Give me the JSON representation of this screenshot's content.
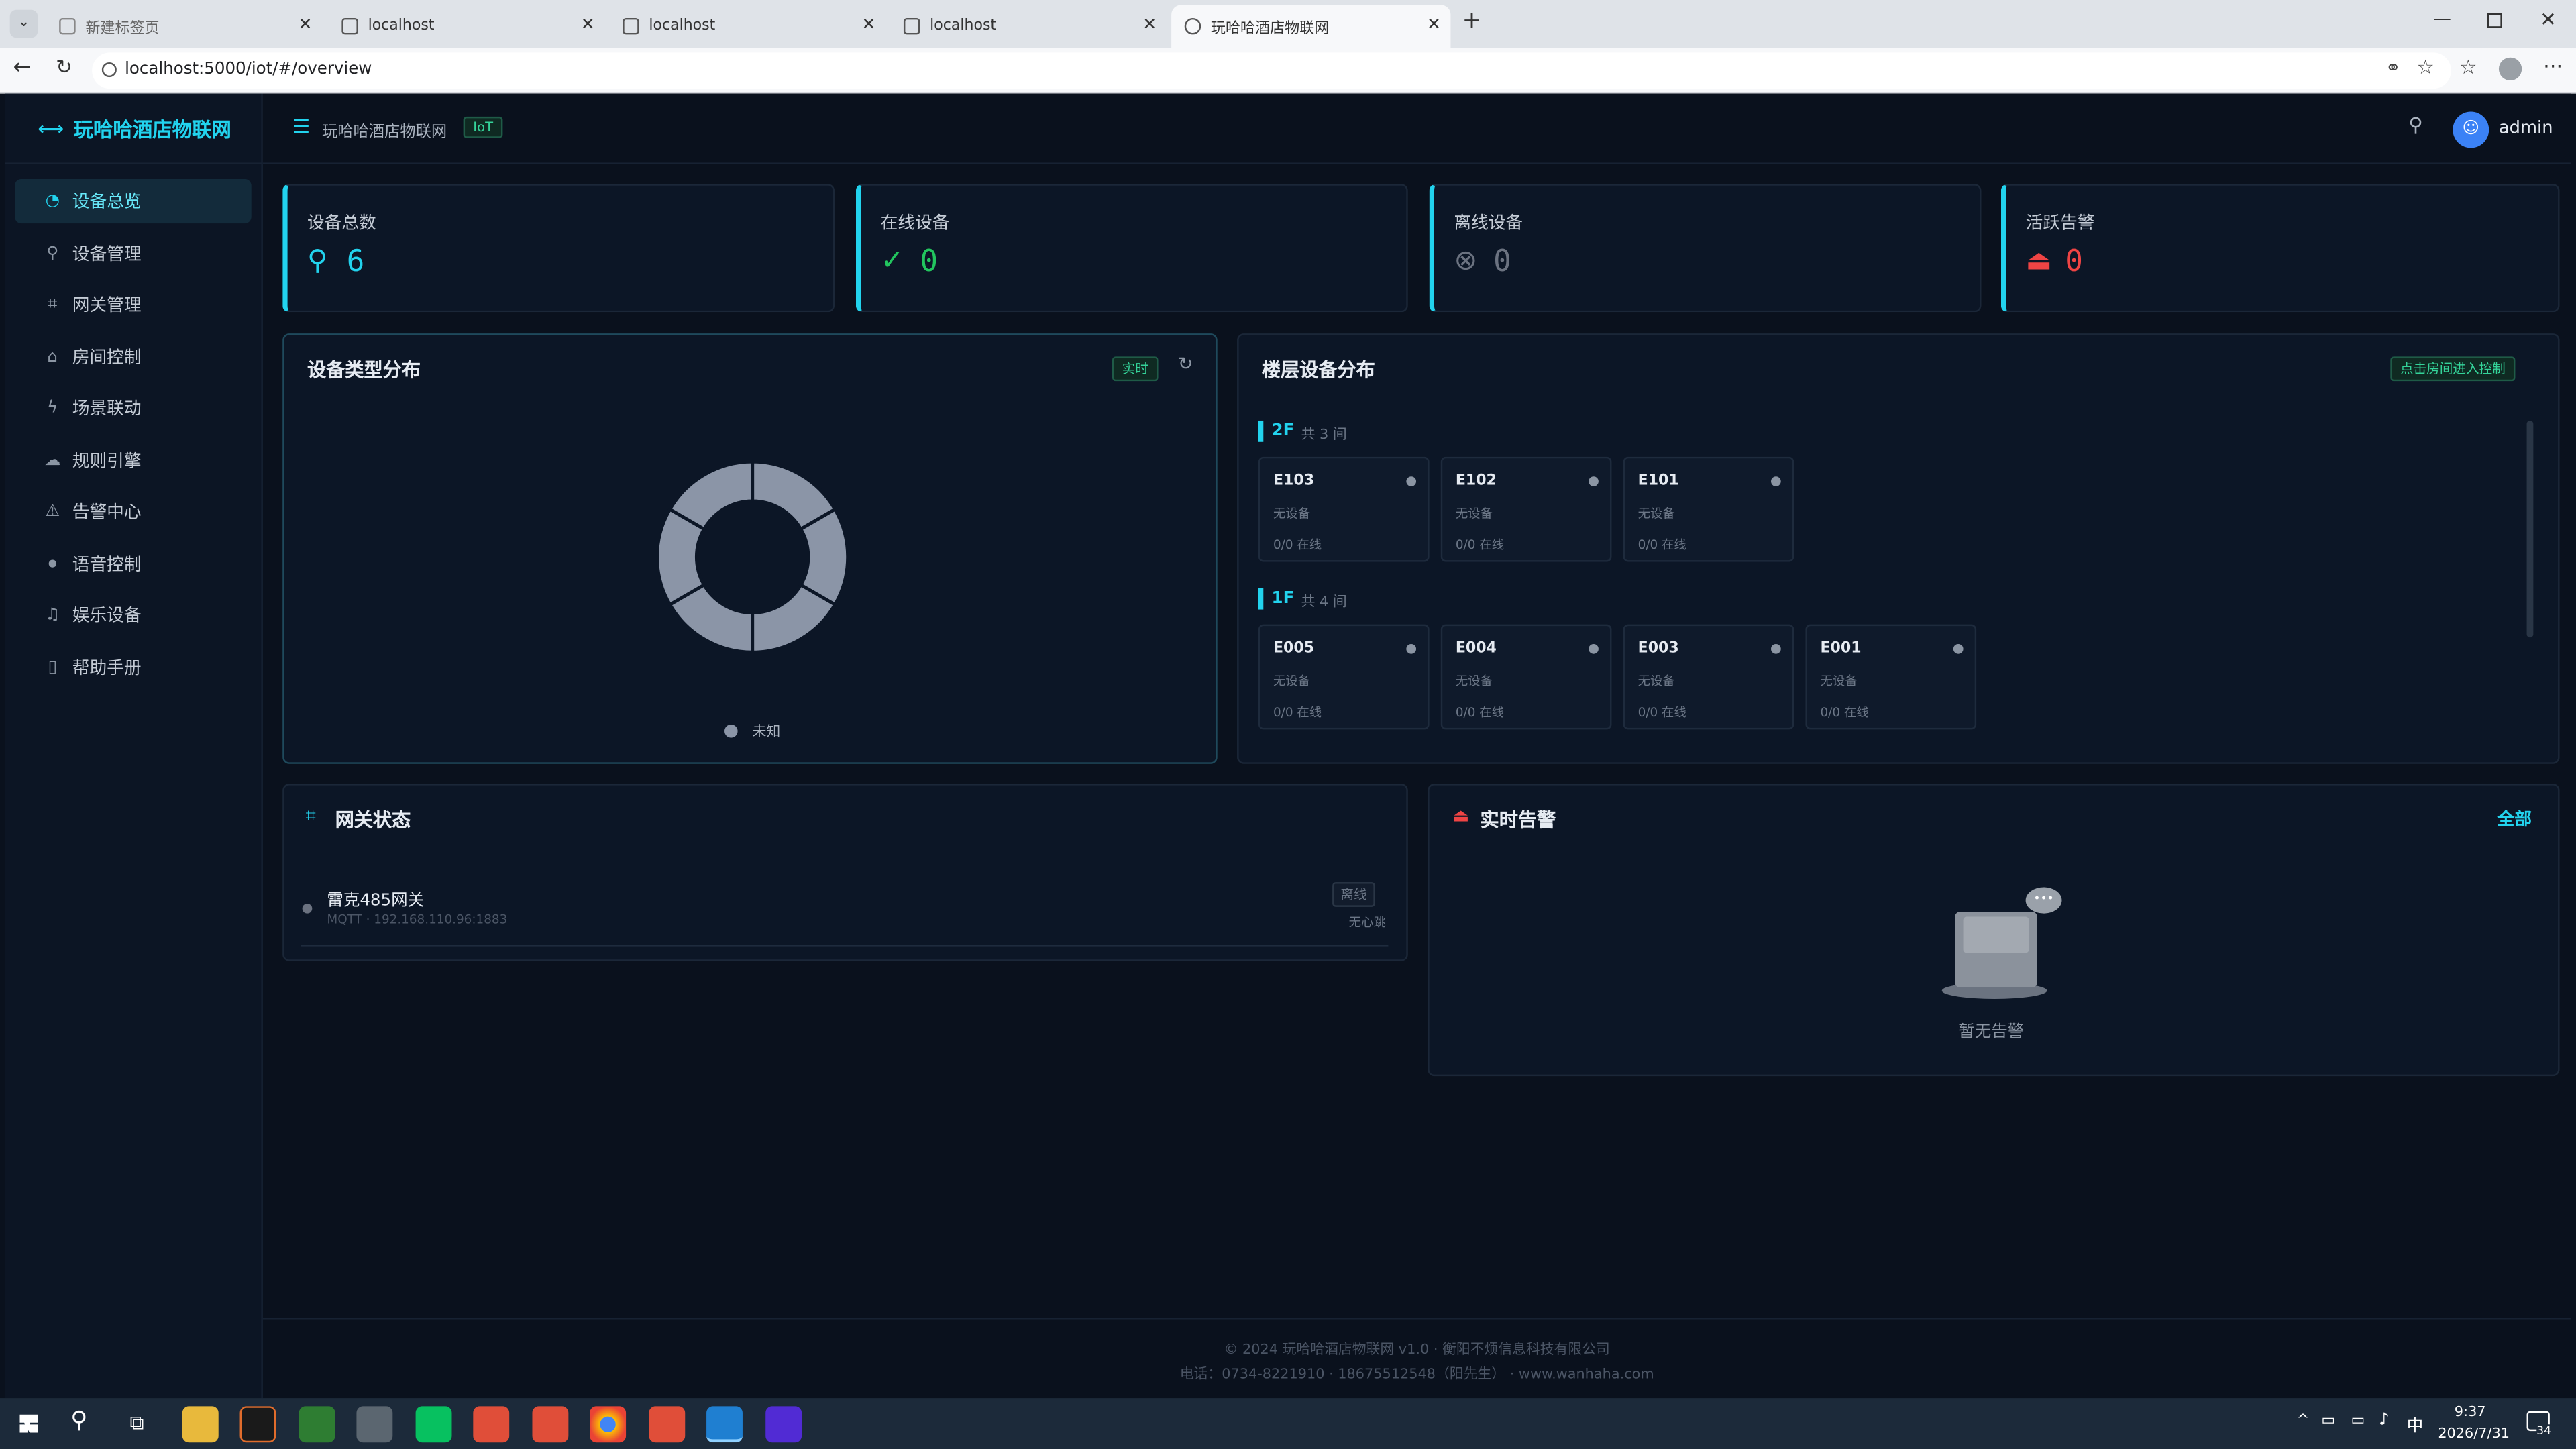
{
  "browser": {
    "tabs": [
      {
        "label": "新建标签页"
      },
      {
        "label": "localhost"
      },
      {
        "label": "localhost"
      },
      {
        "label": "localhost"
      },
      {
        "label": "玩哈哈酒店物联网"
      }
    ],
    "url": "localhost:5000/iot/#/overview"
  },
  "app": {
    "brand": "玩哈哈酒店物联网",
    "breadcrumb": "玩哈哈酒店物联网",
    "badge": "IoT",
    "user": "admin"
  },
  "sidebar": {
    "items": [
      {
        "label": "设备总览",
        "icon": "dashboard-icon"
      },
      {
        "label": "设备管理",
        "icon": "link-icon"
      },
      {
        "label": "网关管理",
        "icon": "gateway-icon"
      },
      {
        "label": "房间控制",
        "icon": "home-icon"
      },
      {
        "label": "场景联动",
        "icon": "bolt-icon"
      },
      {
        "label": "规则引擎",
        "icon": "cloud-icon"
      },
      {
        "label": "告警中心",
        "icon": "alarm-icon"
      },
      {
        "label": "语音控制",
        "icon": "mic-icon"
      },
      {
        "label": "娱乐设备",
        "icon": "speaker-icon"
      },
      {
        "label": "帮助手册",
        "icon": "book-icon"
      }
    ]
  },
  "stats": [
    {
      "label": "设备总数",
      "value": "6",
      "color": "#22d3ee"
    },
    {
      "label": "在线设备",
      "value": "0",
      "color": "#22c55e"
    },
    {
      "label": "离线设备",
      "value": "0",
      "color": "#6b7280"
    },
    {
      "label": "活跃告警",
      "value": "0",
      "color": "#ef4444"
    }
  ],
  "type_chart": {
    "title": "设备类型分布",
    "tag": "实时",
    "legend": "未知",
    "slices": [
      1,
      1,
      1,
      1,
      1,
      1
    ],
    "color": "#8b95a7"
  },
  "floors": {
    "title": "楼层设备分布",
    "action": "点击房间进入控制",
    "list": [
      {
        "name": "2F",
        "count": "共 3 间",
        "rooms": [
          {
            "name": "E103",
            "devices": "无设备",
            "online": "0/0 在线"
          },
          {
            "name": "E102",
            "devices": "无设备",
            "online": "0/0 在线"
          },
          {
            "name": "E101",
            "devices": "无设备",
            "online": "0/0 在线"
          }
        ]
      },
      {
        "name": "1F",
        "count": "共 4 间",
        "rooms": [
          {
            "name": "E005",
            "devices": "无设备",
            "online": "0/0 在线"
          },
          {
            "name": "E004",
            "devices": "无设备",
            "online": "0/0 在线"
          },
          {
            "name": "E003",
            "devices": "无设备",
            "online": "0/0 在线"
          },
          {
            "name": "E001",
            "devices": "无设备",
            "online": "0/0 在线"
          }
        ]
      }
    ]
  },
  "gateway": {
    "title": "网关状态",
    "name": "雷克485网关",
    "detail": "MQTT · 192.168.110.96:1883",
    "status": "离线",
    "heartbeat": "无心跳"
  },
  "alerts": {
    "title": "实时告警",
    "all": "全部",
    "empty": "暂无告警"
  },
  "footer": {
    "line1": "© 2024 玩哈哈酒店物联网 v1.0 · 衡阳不烦信息科技有限公司",
    "line2": "电话：0734-8221910 · 18675512548（阳先生） · www.wanhaha.com"
  },
  "taskbar": {
    "time": "9:37",
    "date": "2026/7/31",
    "ime": "中",
    "notifications": "34"
  }
}
